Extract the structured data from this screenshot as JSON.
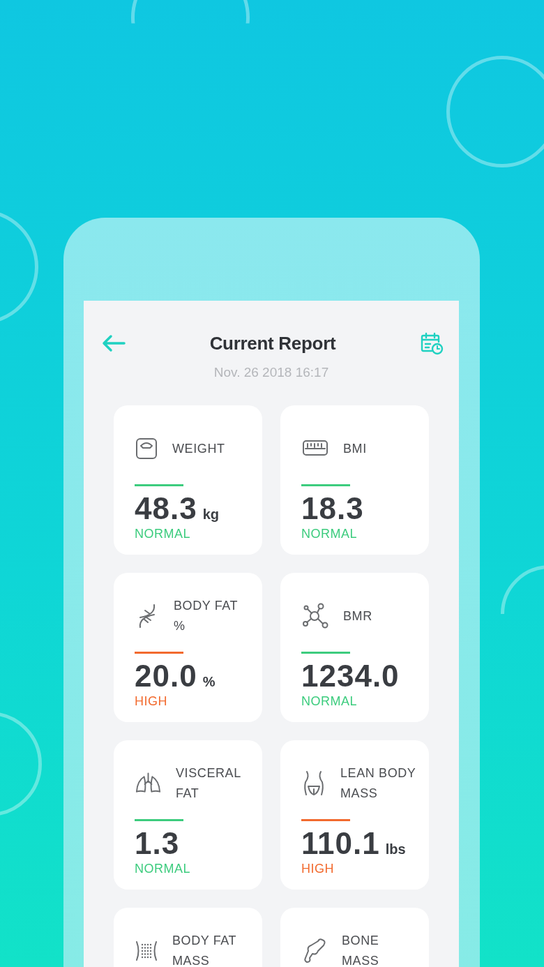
{
  "header": {
    "title": "Current Report",
    "date": "Nov. 26 2018 16:17"
  },
  "cards": [
    {
      "label": "WEIGHT",
      "value": "48.3",
      "unit": "kg",
      "status": "NORMAL",
      "color": "#3dcc7e"
    },
    {
      "label": "BMI",
      "value": "18.3",
      "status": "NORMAL",
      "color": "#3dcc7e"
    },
    {
      "label": "BODY FAT %",
      "value": "20.0",
      "unit": "%",
      "status": "HIGH",
      "color": "#f26a2e"
    },
    {
      "label": "BMR",
      "value": "1234.0",
      "status": "NORMAL",
      "color": "#3dcc7e"
    },
    {
      "label": "VISCERAL FAT",
      "value": "1.3",
      "status": "NORMAL",
      "color": "#3dcc7e"
    },
    {
      "label": "LEAN BODY MASS",
      "value": "110.1",
      "unit": "lbs",
      "status": "HIGH",
      "color": "#f26a2e"
    },
    {
      "label": "BODY FAT MASS"
    },
    {
      "label": "BONE MASS"
    }
  ]
}
